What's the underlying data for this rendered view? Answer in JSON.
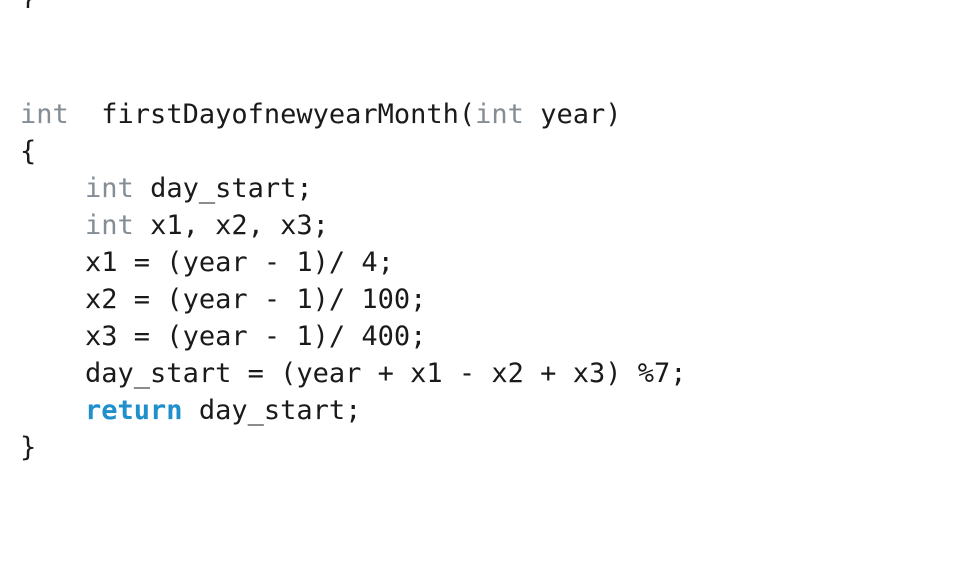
{
  "document": {
    "kind": "code-snippet",
    "language": "C",
    "background_color": "#ffffff"
  },
  "theme": {
    "plain_color": "#1a1a1a",
    "type_keyword_color": "#848c94",
    "flow_keyword_color": "#1f90cc"
  },
  "clipped_top_fragment": "}",
  "code": {
    "lines": [
      {
        "id": "line-signature",
        "indent": "",
        "segments": [
          {
            "text": "int",
            "kind": "type-keyword"
          },
          {
            "text": "  firstDayofnewyearMonth(",
            "kind": "plain"
          },
          {
            "text": "int",
            "kind": "type-keyword"
          },
          {
            "text": " year)",
            "kind": "plain"
          }
        ]
      },
      {
        "id": "line-open-brace",
        "indent": "",
        "segments": [
          {
            "text": "{",
            "kind": "plain"
          }
        ]
      },
      {
        "id": "line-decl-day-start",
        "indent": "    ",
        "segments": [
          {
            "text": "int",
            "kind": "type-keyword"
          },
          {
            "text": " day_start;",
            "kind": "plain"
          }
        ]
      },
      {
        "id": "line-decl-x123",
        "indent": "    ",
        "segments": [
          {
            "text": "int",
            "kind": "type-keyword"
          },
          {
            "text": " x1, x2, x3;",
            "kind": "plain"
          }
        ]
      },
      {
        "id": "line-assign-x1",
        "indent": "    ",
        "segments": [
          {
            "text": "x1 = (year - 1)/ 4;",
            "kind": "plain"
          }
        ]
      },
      {
        "id": "line-assign-x2",
        "indent": "    ",
        "segments": [
          {
            "text": "x2 = (year - 1)/ 100;",
            "kind": "plain"
          }
        ]
      },
      {
        "id": "line-assign-x3",
        "indent": "    ",
        "segments": [
          {
            "text": "x3 = (year - 1)/ 400;",
            "kind": "plain"
          }
        ]
      },
      {
        "id": "line-assign-day-start",
        "indent": "    ",
        "segments": [
          {
            "text": "day_start = (year + x1 - x2 + x3) %7;",
            "kind": "plain"
          }
        ]
      },
      {
        "id": "line-return",
        "indent": "    ",
        "segments": [
          {
            "text": "return",
            "kind": "flow-keyword"
          },
          {
            "text": " day_start;",
            "kind": "plain"
          }
        ]
      },
      {
        "id": "line-close-brace",
        "indent": "",
        "segments": [
          {
            "text": "}",
            "kind": "plain"
          }
        ]
      }
    ]
  }
}
